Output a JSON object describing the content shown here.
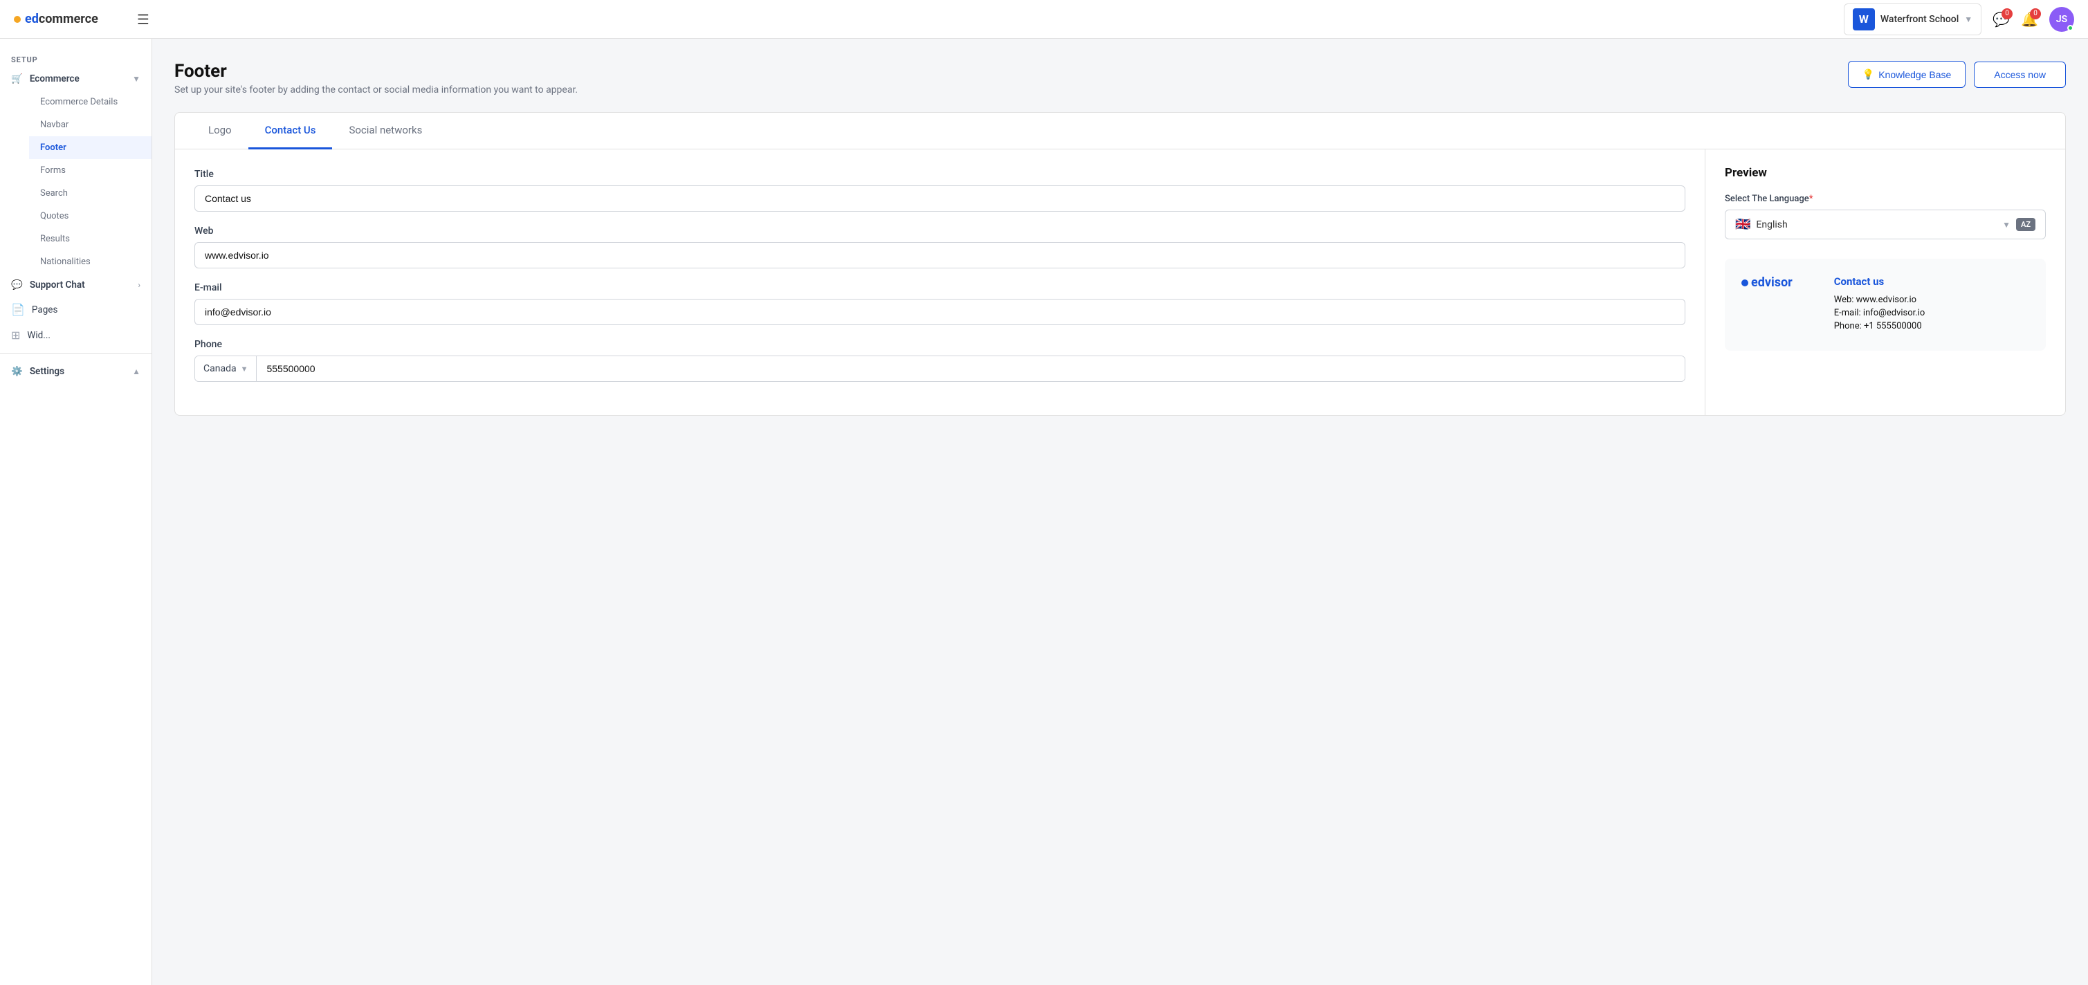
{
  "app": {
    "logo_prefix": "ed",
    "logo_suffix": "commerce"
  },
  "topnav": {
    "hamburger_label": "☰",
    "school": {
      "initial": "W",
      "name": "Waterfront School"
    },
    "notifications_count_1": "0",
    "notifications_count_2": "0",
    "avatar_initials": "JS"
  },
  "sidebar": {
    "setup_label": "SETUP",
    "ecommerce_label": "Ecommerce",
    "ecommerce_items": [
      {
        "label": "Ecommerce Details"
      },
      {
        "label": "Navbar"
      },
      {
        "label": "Footer"
      },
      {
        "label": "Forms"
      },
      {
        "label": "Search"
      },
      {
        "label": "Quotes"
      },
      {
        "label": "Results"
      },
      {
        "label": "Nationalities"
      }
    ],
    "support_chat_label": "Support Chat",
    "pages_label": "Pages",
    "widgets_label": "Wid...",
    "settings_label": "Settings"
  },
  "page": {
    "title": "Footer",
    "description": "Set up your site's footer by adding the contact or social media information you want to appear.",
    "knowledge_base_btn": "Knowledge Base",
    "access_now_btn": "Access now"
  },
  "tabs": [
    {
      "label": "Logo"
    },
    {
      "label": "Contact Us",
      "active": true
    },
    {
      "label": "Social networks"
    }
  ],
  "form": {
    "title_label": "Title",
    "title_value": "Contact us",
    "web_label": "Web",
    "web_value": "www.edvisor.io",
    "email_label": "E-mail",
    "email_value": "info@edvisor.io",
    "phone_label": "Phone",
    "phone_country": "Canada",
    "phone_number": "555500000"
  },
  "preview": {
    "title": "Preview",
    "lang_label": "Select The Language",
    "lang_required": "*",
    "language": "English",
    "flag": "🇬🇧",
    "translate_btn": "AZ",
    "footer": {
      "logo_dot": "●",
      "logo_text": "edvisor",
      "contact_title": "Contact us",
      "web_label": "Web:",
      "web_value": "www.edvisor.io",
      "email_label": "E-mail:",
      "email_value": "info@edvisor.io",
      "phone_label": "Phone:",
      "phone_value": "+1 555500000"
    }
  }
}
